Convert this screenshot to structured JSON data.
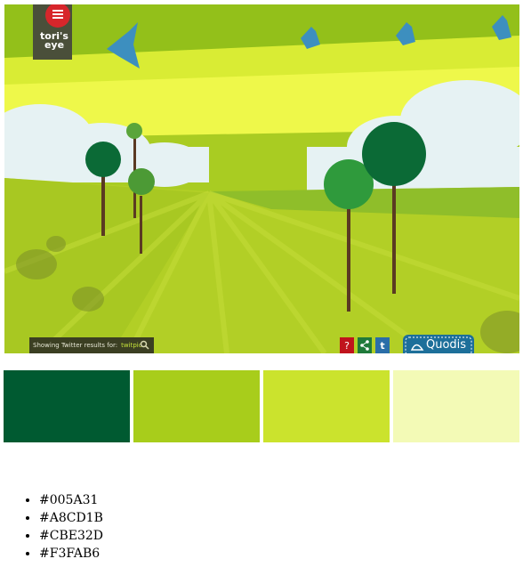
{
  "logo": {
    "text": "tori's eye"
  },
  "twitter_bar": {
    "label": "Showing Twitter results for:",
    "term": "twitpic"
  },
  "sponsor": {
    "name": "Quodis"
  },
  "palette": {
    "swatches": [
      {
        "hex": "#005A31"
      },
      {
        "hex": "#A8CD1B"
      },
      {
        "hex": "#CBE32D"
      },
      {
        "hex": "#F3FAB6"
      }
    ]
  },
  "icons": {
    "help": "question-icon",
    "share": "share-icon",
    "twitter": "twitter-icon",
    "search": "search-icon"
  },
  "colors": {
    "sky_top": "#9cc61a",
    "sky_band": "#e8f53c",
    "field": "#b6d22a",
    "tree_dark": "#0b6a36",
    "tree_mid": "#2f9a3c",
    "bird": "#3d8fbf",
    "logo_red": "#d7262b",
    "button_red": "#c0141c",
    "button_green": "#1f7a3a",
    "button_blue": "#2a6ea8",
    "quodis_blue": "#1d6f9a"
  }
}
